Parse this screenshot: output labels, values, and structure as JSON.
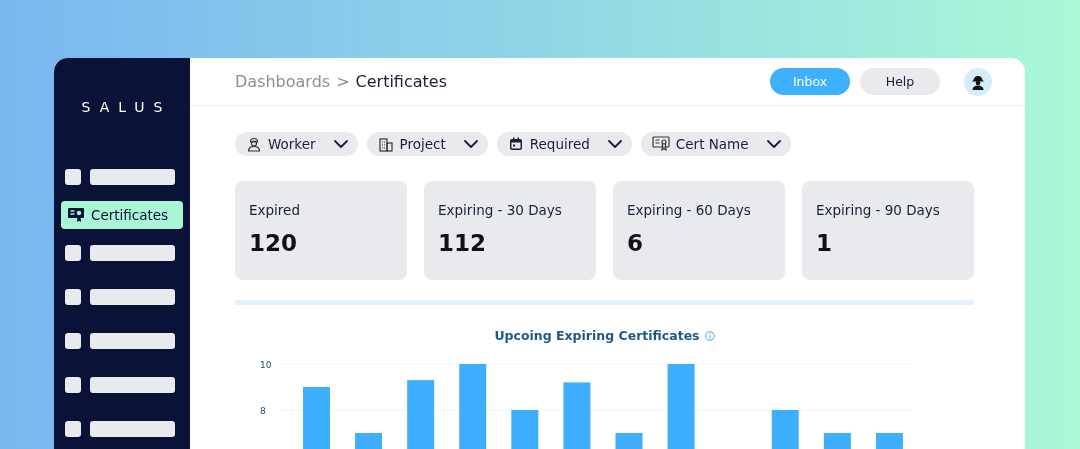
{
  "sidebar": {
    "logo": "SALUS",
    "items": [
      {
        "kind": "placeholder",
        "selected": false
      },
      {
        "kind": "link",
        "label": "Certificates",
        "selected": true
      },
      {
        "kind": "placeholder",
        "selected": false
      },
      {
        "kind": "placeholder",
        "selected": false
      },
      {
        "kind": "placeholder",
        "selected": false
      },
      {
        "kind": "placeholder",
        "selected": false
      },
      {
        "kind": "placeholder",
        "selected": false
      }
    ]
  },
  "header": {
    "breadcrumb": {
      "parent": "Dashboards",
      "separator": ">",
      "current": "Certificates"
    },
    "buttons": [
      {
        "label": "Inbox",
        "primary": true
      },
      {
        "label": "Help",
        "primary": false
      }
    ]
  },
  "filters": [
    {
      "kind": "worker",
      "label": "Worker"
    },
    {
      "kind": "project",
      "label": "Project"
    },
    {
      "kind": "calendar",
      "label": "Required"
    },
    {
      "kind": "cert",
      "label": "Cert Name"
    }
  ],
  "stats": [
    {
      "label": "Expired",
      "value": "120"
    },
    {
      "label": "Expiring - 30 Days",
      "value": "112"
    },
    {
      "label": "Expiring - 60 Days",
      "value": "6"
    },
    {
      "label": "Expiring - 90 Days",
      "value": "1"
    }
  ],
  "chart": {
    "chart_data": {
      "type": "bar",
      "title": "Upcoing Expiring Certificates",
      "series": [
        {
          "color": "#3eaffe",
          "values": [
            9,
            7,
            9.3,
            10,
            8,
            9.2,
            7,
            10,
            null,
            8,
            7,
            7
          ]
        }
      ],
      "ylim": [
        0,
        10
      ],
      "yticks": [
        8,
        10
      ]
    }
  }
}
